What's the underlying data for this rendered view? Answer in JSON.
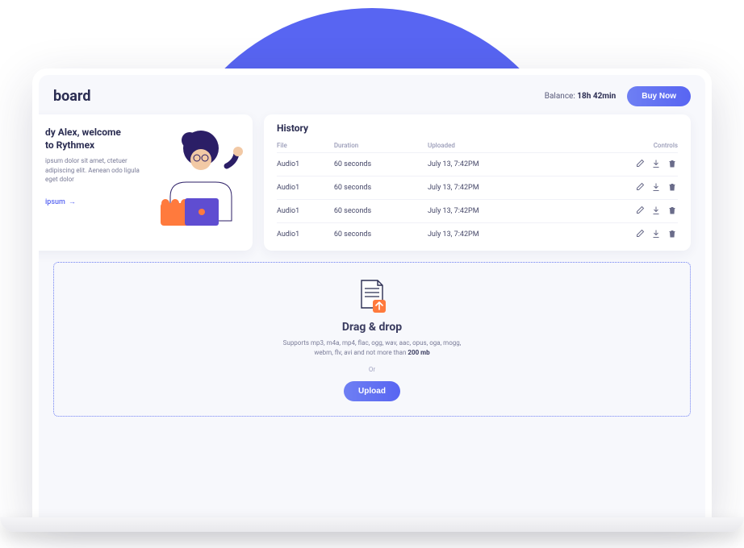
{
  "header": {
    "page_title": "board",
    "balance_label": "Balance:",
    "balance_value": "18h 42min",
    "buy_button": "Buy Now"
  },
  "welcome": {
    "title_line1": "dy Alex, welcome",
    "title_line2": "to Rythmex",
    "desc": "ipsum dolor sit amet, ctetuer adipiscing elit. Aenean odo ligula eget dolor",
    "link_label": "ipsum"
  },
  "history": {
    "title": "History",
    "columns": {
      "file": "File",
      "duration": "Duration",
      "uploaded": "Uploaded",
      "controls": "Controls"
    },
    "rows": [
      {
        "file": "Audio1",
        "duration": "60 seconds",
        "uploaded": "July 13, 7:42PM"
      },
      {
        "file": "Audio1",
        "duration": "60 seconds",
        "uploaded": "July 13, 7:42PM"
      },
      {
        "file": "Audio1",
        "duration": "60 seconds",
        "uploaded": "July 13, 7:42PM"
      },
      {
        "file": "Audio1",
        "duration": "60 seconds",
        "uploaded": "July 13, 7:42PM"
      }
    ]
  },
  "dropzone": {
    "title": "Drag & drop",
    "desc_pre": "Supports mp3, m4a, mp4, flac, ogg, wav, aac, opus, oga, mogg, webm, flv, avi and not more than ",
    "desc_bold": "200 mb",
    "or_label": "Or",
    "upload_button": "Upload"
  }
}
